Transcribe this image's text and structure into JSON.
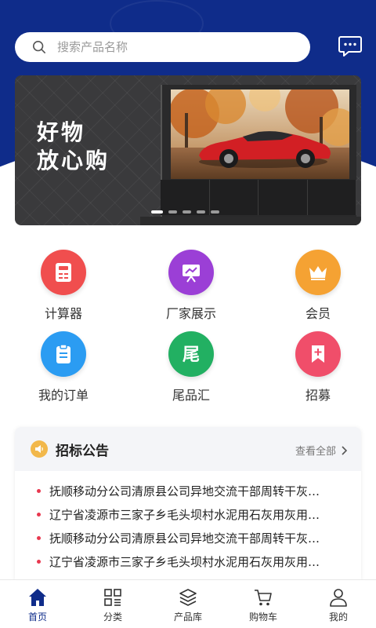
{
  "header": {
    "search_placeholder": "搜索产品名称",
    "icons": {
      "search": "search-icon",
      "message": "message-icon"
    },
    "colors": {
      "primary": "#0f2c8a"
    }
  },
  "banner": {
    "slogan_line1": "好物",
    "slogan_line2": "放心购",
    "slide_count": 5,
    "active_slide": 1
  },
  "menu": {
    "items": [
      {
        "label": "计算器",
        "icon": "calculator-icon",
        "color": "#f04e4e"
      },
      {
        "label": "厂家展示",
        "icon": "easel-icon",
        "color": "#9b3fd6"
      },
      {
        "label": "会员",
        "icon": "crown-icon",
        "color": "#f5a233"
      },
      {
        "label": "我的订单",
        "icon": "order-clipboard-icon",
        "color": "#2b9cf2"
      },
      {
        "label": "尾品汇",
        "icon": "tail-character-icon",
        "color": "#22b062"
      },
      {
        "label": "招募",
        "icon": "recruit-bookmark-icon",
        "color": "#f04e6a"
      }
    ]
  },
  "notice": {
    "title": "招标公告",
    "more_label": "查看全部",
    "items": [
      "抚顺移动分公司清原县公司异地交流干部周转干灰…",
      "辽宁省凌源市三家子乡毛头坝村水泥用石灰用灰用…",
      "抚顺移动分公司清原县公司异地交流干部周转干灰…",
      "辽宁省凌源市三家子乡毛头坝村水泥用石灰用灰用…"
    ]
  },
  "tabbar": {
    "tabs": [
      {
        "label": "首页",
        "icon": "home-icon",
        "active": true
      },
      {
        "label": "分类",
        "icon": "category-icon",
        "active": false
      },
      {
        "label": "产品库",
        "icon": "product-library-icon",
        "active": false
      },
      {
        "label": "购物车",
        "icon": "cart-icon",
        "active": false
      },
      {
        "label": "我的",
        "icon": "profile-icon",
        "active": false
      }
    ]
  }
}
